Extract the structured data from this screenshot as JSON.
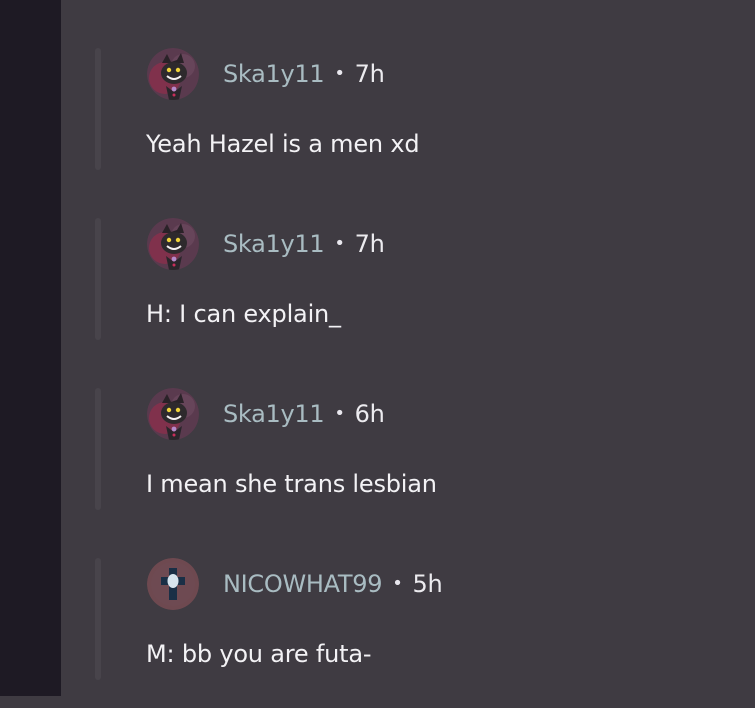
{
  "comments": [
    {
      "username": "Ska1y11",
      "separator": "•",
      "time": "7h",
      "text": "Yeah Hazel is a men xd",
      "avatar": "dark-character-avatar"
    },
    {
      "username": "Ska1y11",
      "separator": "•",
      "time": "7h",
      "text": "H: I can explain_",
      "avatar": "dark-character-avatar"
    },
    {
      "username": "Ska1y11",
      "separator": "•",
      "time": "6h",
      "text": "I mean she trans lesbian",
      "avatar": "dark-character-avatar"
    },
    {
      "username": "NICOWHAT99",
      "separator": "•",
      "time": "5h",
      "text": "M: bb you are futa-",
      "avatar": "cross-emblem-avatar"
    }
  ],
  "colors": {
    "background": "#3f3b42",
    "left_rail": "#1e1a24",
    "username": "#a9bcc2",
    "text": "#f3f2f5"
  }
}
